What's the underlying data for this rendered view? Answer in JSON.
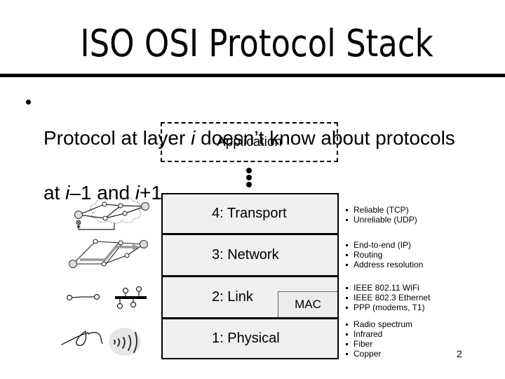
{
  "slide": {
    "title": "ISO OSI Protocol Stack",
    "page_number": "2"
  },
  "bullet": {
    "lines": [
      [
        {
          "text": "Protocol at layer ",
          "italic": false
        },
        {
          "text": "i",
          "italic": true
        },
        {
          "text": " doesn’t know about protocols",
          "italic": false
        }
      ],
      [
        {
          "text": "at ",
          "italic": false
        },
        {
          "text": "i",
          "italic": true
        },
        {
          "text": "–1 and ",
          "italic": false
        },
        {
          "text": "i",
          "italic": true
        },
        {
          "text": "+1",
          "italic": false
        }
      ]
    ]
  },
  "stack": {
    "application_label": "Application",
    "layers": [
      {
        "label": "4: Transport",
        "notes": [
          "Reliable (TCP)",
          "Unreliable (UDP)"
        ]
      },
      {
        "label": "3: Network",
        "notes": [
          "End-to-end (IP)",
          "Routing",
          "Address resolution"
        ]
      },
      {
        "label": "2: Link",
        "sublayer": "MAC",
        "notes": [
          "IEEE 802.11 WiFi",
          "IEEE 802.3 Ethernet",
          "PPP (modems, T1)"
        ]
      },
      {
        "label": "1: Physical",
        "notes": [
          "Radio spectrum",
          "Infrared",
          "Fiber",
          "Copper"
        ]
      }
    ]
  },
  "icons": {
    "bullet": "bullet-icon",
    "ellipsis": "vertical-ellipsis-icon",
    "transport": "cloud-network-icon",
    "network": "routed-network-icon",
    "link": [
      "point-to-point-link-icon",
      "shared-bus-icon"
    ],
    "physical": [
      "wire-icon",
      "radio-waves-icon"
    ]
  },
  "colors": {
    "text": "#000000",
    "layer_fill": "#f0f0f0",
    "mac_fill": "#ececec",
    "route_arrow": "#999999",
    "radio_oval": "#e6e6e6"
  }
}
